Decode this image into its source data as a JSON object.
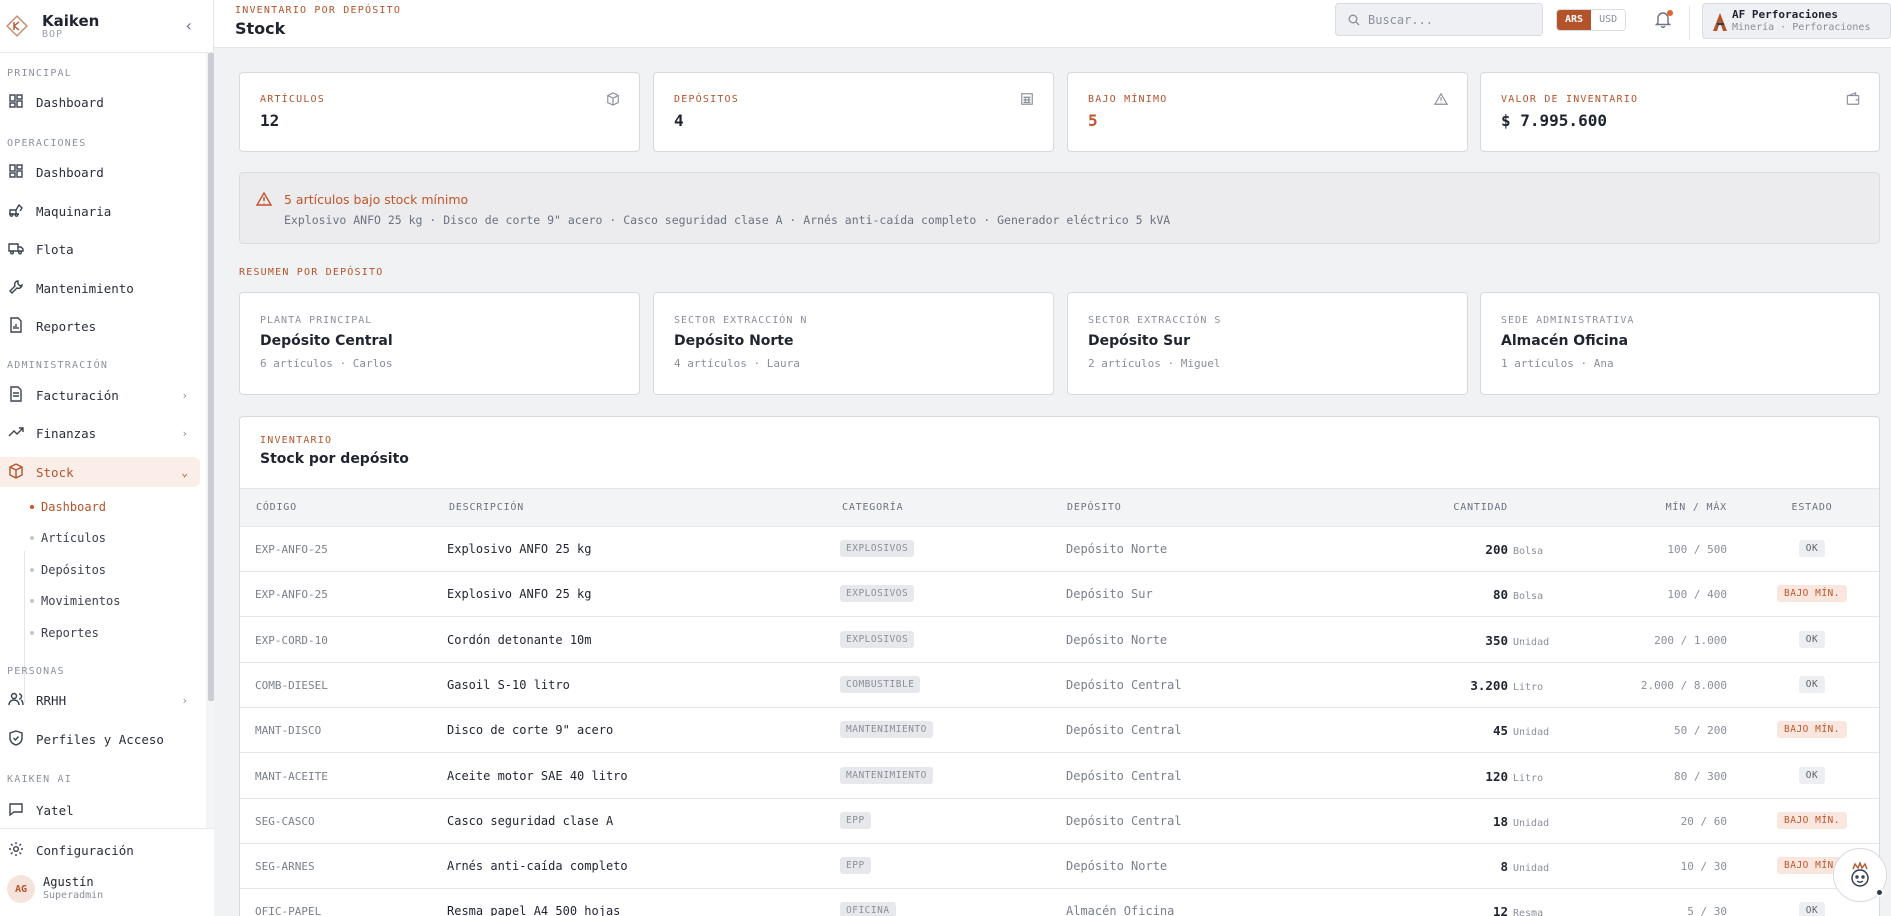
{
  "brand": {
    "name": "Kaiken",
    "sub": "BOP"
  },
  "header": {
    "eyebrow": "INVENTARIO POR DEPÓSITO",
    "title": "Stock",
    "search_placeholder": "Buscar...",
    "currency_on": "ARS",
    "currency_off": "USD",
    "company_name": "AF Perforaciones",
    "company_sub": "Minería · Perforaciones"
  },
  "sidebar": {
    "sections": [
      "PRINCIPAL",
      "OPERACIONES",
      "ADMINISTRACIÓN",
      "PERSONAS",
      "KAIKEN AI"
    ],
    "items": {
      "dashboard_main": "Dashboard",
      "dashboard_ops": "Dashboard",
      "maquinaria": "Maquinaria",
      "flota": "Flota",
      "mantenimiento": "Mantenimiento",
      "reportes": "Reportes",
      "facturacion": "Facturación",
      "finanzas": "Finanzas",
      "stock": "Stock",
      "rrhh": "RRHH",
      "perfiles": "Perfiles y Acceso",
      "yatel": "Yatel"
    },
    "stock_sub": [
      "Dashboard",
      "Artículos",
      "Depósitos",
      "Movimientos",
      "Reportes"
    ],
    "config": "Configuración",
    "user": {
      "initials": "AG",
      "name": "Agustín",
      "role": "Superadmin"
    }
  },
  "stats": [
    {
      "label": "ARTÍCULOS",
      "value": "12",
      "icon": "box-icon"
    },
    {
      "label": "DEPÓSITOS",
      "value": "4",
      "icon": "warehouse-icon"
    },
    {
      "label": "BAJO MÍNIMO",
      "value": "5",
      "icon": "alert-triangle-icon"
    },
    {
      "label": "VALOR DE INVENTARIO",
      "value": "$ 7.995.600",
      "icon": "wallet-icon"
    }
  ],
  "alert": {
    "title": "5 artículos bajo stock mínimo",
    "list": "Explosivo ANFO 25 kg · Disco de corte 9\" acero · Casco seguridad clase A · Arnés anti-caída completo · Generador eléctrico 5 kVA"
  },
  "summary_label": "RESUMEN POR DEPÓSITO",
  "deposits": [
    {
      "label": "PLANTA PRINCIPAL",
      "name": "Depósito Central",
      "meta": "6 artículos · Carlos"
    },
    {
      "label": "SECTOR EXTRACCIÓN N",
      "name": "Depósito Norte",
      "meta": "4 artículos · Laura"
    },
    {
      "label": "SECTOR EXTRACCIÓN S",
      "name": "Depósito Sur",
      "meta": "2 artículos · Miguel"
    },
    {
      "label": "SEDE ADMINISTRATIVA",
      "name": "Almacén Oficina",
      "meta": "1 artículos · Ana"
    }
  ],
  "table": {
    "eyebrow": "INVENTARIO",
    "title": "Stock por depósito",
    "headers": [
      "CÓDIGO",
      "DESCRIPCIÓN",
      "CATEGORÍA",
      "DEPÓSITO",
      "CANTIDAD",
      "MÍN / MÁX",
      "ESTADO"
    ],
    "rows": [
      {
        "code": "EXP-ANFO-25",
        "desc": "Explosivo ANFO 25 kg",
        "cat": "EXPLOSIVOS",
        "dep": "Depósito Norte",
        "qty": "200",
        "unit": "Bolsa",
        "mm": "100 / 500",
        "status": "OK",
        "low": false
      },
      {
        "code": "EXP-ANFO-25",
        "desc": "Explosivo ANFO 25 kg",
        "cat": "EXPLOSIVOS",
        "dep": "Depósito Sur",
        "qty": "80",
        "unit": "Bolsa",
        "mm": "100 / 400",
        "status": "BAJO MÍN.",
        "low": true
      },
      {
        "code": "EXP-CORD-10",
        "desc": "Cordón detonante 10m",
        "cat": "EXPLOSIVOS",
        "dep": "Depósito Norte",
        "qty": "350",
        "unit": "Unidad",
        "mm": "200 / 1.000",
        "status": "OK",
        "low": false
      },
      {
        "code": "COMB-DIESEL",
        "desc": "Gasoil S-10 litro",
        "cat": "COMBUSTIBLE",
        "dep": "Depósito Central",
        "qty": "3.200",
        "unit": "Litro",
        "mm": "2.000 / 8.000",
        "status": "OK",
        "low": false
      },
      {
        "code": "MANT-DISCO",
        "desc": "Disco de corte 9\" acero",
        "cat": "MANTENIMIENTO",
        "dep": "Depósito Central",
        "qty": "45",
        "unit": "Unidad",
        "mm": "50 / 200",
        "status": "BAJO MÍN.",
        "low": true
      },
      {
        "code": "MANT-ACEITE",
        "desc": "Aceite motor SAE 40 litro",
        "cat": "MANTENIMIENTO",
        "dep": "Depósito Central",
        "qty": "120",
        "unit": "Litro",
        "mm": "80 / 300",
        "status": "OK",
        "low": false
      },
      {
        "code": "SEG-CASCO",
        "desc": "Casco seguridad clase A",
        "cat": "EPP",
        "dep": "Depósito Central",
        "qty": "18",
        "unit": "Unidad",
        "mm": "20 / 60",
        "status": "BAJO MÍN.",
        "low": true
      },
      {
        "code": "SEG-ARNES",
        "desc": "Arnés anti-caída completo",
        "cat": "EPP",
        "dep": "Depósito Norte",
        "qty": "8",
        "unit": "Unidad",
        "mm": "10 / 30",
        "status": "BAJO MÍN.",
        "low": true
      },
      {
        "code": "OFIC-PAPEL",
        "desc": "Resma papel A4 500 hojas",
        "cat": "OFICINA",
        "dep": "Almacén Oficina",
        "qty": "12",
        "unit": "Resma",
        "mm": "5 / 30",
        "status": "OK",
        "low": false
      }
    ]
  },
  "colors": {
    "accent": "#b4532a",
    "warning": "#c2552a",
    "background": "#f1f2f4"
  }
}
